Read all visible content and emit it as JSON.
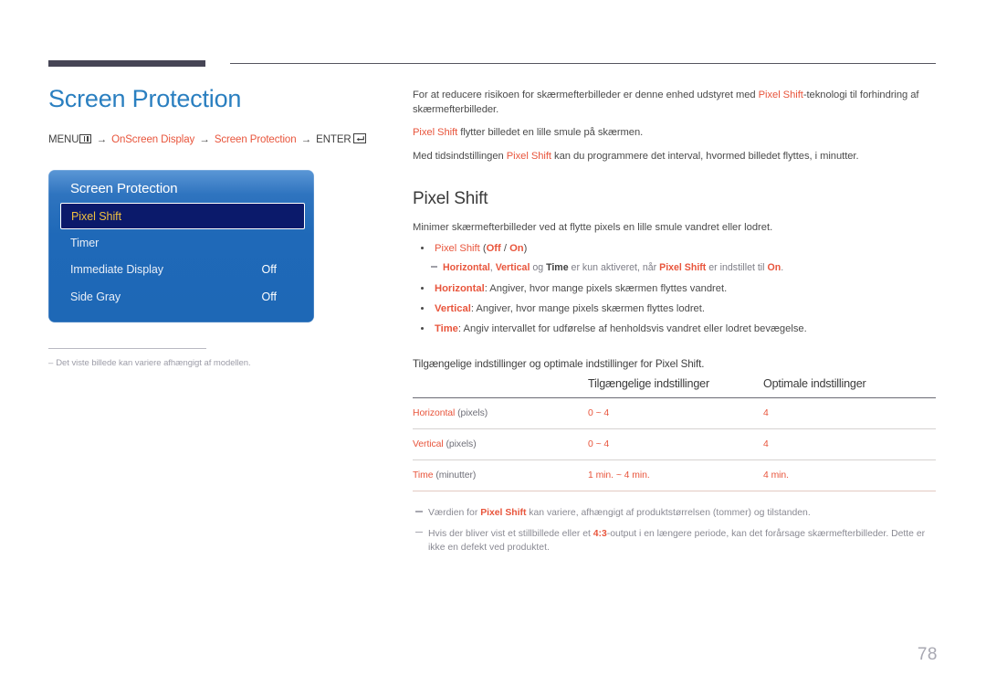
{
  "document": {
    "page_number": "78"
  },
  "left": {
    "page_title": "Screen Protection",
    "breadcrumb": {
      "menu_label": "MENU",
      "menu_icon": "menu-bars-icon",
      "arrow": "→",
      "step1": "OnScreen Display",
      "step2": "Screen Protection",
      "enter_label": "ENTER",
      "enter_icon": "enter-key-icon"
    },
    "osd": {
      "title": "Screen Protection",
      "rows": [
        {
          "label": "Pixel Shift",
          "value": "",
          "selected": true
        },
        {
          "label": "Timer",
          "value": "",
          "selected": false
        },
        {
          "label": "Immediate Display",
          "value": "Off",
          "selected": false
        },
        {
          "label": "Side Gray",
          "value": "Off",
          "selected": false
        }
      ]
    },
    "note": {
      "dash": "–",
      "text": "Det viste billede kan variere afhængigt af modellen."
    }
  },
  "right": {
    "intro": [
      {
        "parts": [
          {
            "t": "For at reducere risikoen for skærmefterbilleder er denne enhed udstyret med ",
            "s": "plain"
          },
          {
            "t": "Pixel Shift",
            "s": "accent"
          },
          {
            "t": "-teknologi til forhindring af skærmefterbilleder.",
            "s": "plain"
          }
        ]
      },
      {
        "parts": [
          {
            "t": "Pixel Shift",
            "s": "accent"
          },
          {
            "t": " flytter billedet en lille smule på skærmen.",
            "s": "plain"
          }
        ]
      },
      {
        "parts": [
          {
            "t": "Med tidsindstillingen ",
            "s": "plain"
          },
          {
            "t": "Pixel Shift",
            "s": "accent"
          },
          {
            "t": " kan du programmere det interval, hvormed billedet flyttes, i minutter.",
            "s": "plain"
          }
        ]
      }
    ],
    "section_title": "Pixel Shift",
    "lede": "Minimer skærmefterbilleder ved at flytte pixels en lille smule vandret eller lodret.",
    "bullets": [
      {
        "kind": "dot",
        "parts": [
          {
            "t": "Pixel Shift",
            "s": "accent"
          },
          {
            "t": " (",
            "s": "plain"
          },
          {
            "t": "Off",
            "s": "accent-b"
          },
          {
            "t": " / ",
            "s": "plain"
          },
          {
            "t": "On",
            "s": "accent-b"
          },
          {
            "t": ")",
            "s": "plain"
          }
        ]
      },
      {
        "kind": "sub",
        "parts": [
          {
            "t": "Horizontal",
            "s": "accent-b"
          },
          {
            "t": ", ",
            "s": "plain"
          },
          {
            "t": "Vertical",
            "s": "accent-b"
          },
          {
            "t": " og ",
            "s": "plain"
          },
          {
            "t": "Time",
            "s": "strong"
          },
          {
            "t": " er kun aktiveret, når ",
            "s": "plain"
          },
          {
            "t": "Pixel Shift",
            "s": "accent-b"
          },
          {
            "t": " er indstillet til ",
            "s": "plain"
          },
          {
            "t": "On",
            "s": "accent-b"
          },
          {
            "t": ".",
            "s": "plain"
          }
        ]
      },
      {
        "kind": "dot",
        "parts": [
          {
            "t": "Horizontal",
            "s": "accent-b"
          },
          {
            "t": ": Angiver, hvor mange pixels skærmen flyttes vandret.",
            "s": "plain"
          }
        ]
      },
      {
        "kind": "dot",
        "parts": [
          {
            "t": "Vertical",
            "s": "accent-b"
          },
          {
            "t": ": Angiver, hvor mange pixels skærmen flyttes lodret.",
            "s": "plain"
          }
        ]
      },
      {
        "kind": "dot",
        "parts": [
          {
            "t": "Time",
            "s": "accent-b"
          },
          {
            "t": ": Angiv intervallet for udførelse af henholdsvis vandret eller lodret bevægelse.",
            "s": "plain"
          }
        ]
      }
    ],
    "table_caption": "Tilgængelige indstillinger og optimale indstillinger for Pixel Shift.",
    "table": {
      "headers": [
        "",
        "Tilgængelige indstillinger",
        "Optimale indstillinger"
      ],
      "rows": [
        {
          "name": "Horizontal",
          "unit": " (pixels)",
          "available": "0 ~ 4",
          "optimal": "4"
        },
        {
          "name": "Vertical",
          "unit": " (pixels)",
          "available": "0 ~ 4",
          "optimal": "4"
        },
        {
          "name": "Time",
          "unit": " (minutter)",
          "available": "1 min. ~ 4 min.",
          "optimal": "4 min."
        }
      ]
    },
    "footnotes": [
      {
        "parts": [
          {
            "t": "Værdien for ",
            "s": "plain"
          },
          {
            "t": "Pixel Shift",
            "s": "accent-b"
          },
          {
            "t": " kan variere, afhængigt af produktstørrelsen (tommer) og tilstanden.",
            "s": "plain"
          }
        ]
      },
      {
        "parts": [
          {
            "t": "Hvis der bliver vist et stillbillede eller et ",
            "s": "plain"
          },
          {
            "t": "4:3",
            "s": "accent-b"
          },
          {
            "t": "-output i en længere periode, kan det forårsage skærmefterbilleder. Dette er ikke en defekt ved produktet.",
            "s": "plain"
          }
        ]
      }
    ]
  },
  "colors": {
    "title_blue": "#2a7fc0",
    "accent_orange": "#e8553c",
    "osd_blue_top": "#5b97d6",
    "osd_blue_bottom": "#1e68b6",
    "osd_selected_bg": "#0b1a6b",
    "osd_selected_text": "#f0c040",
    "rule_dark": "#464555",
    "page_number_gray": "#a8a8b2"
  }
}
